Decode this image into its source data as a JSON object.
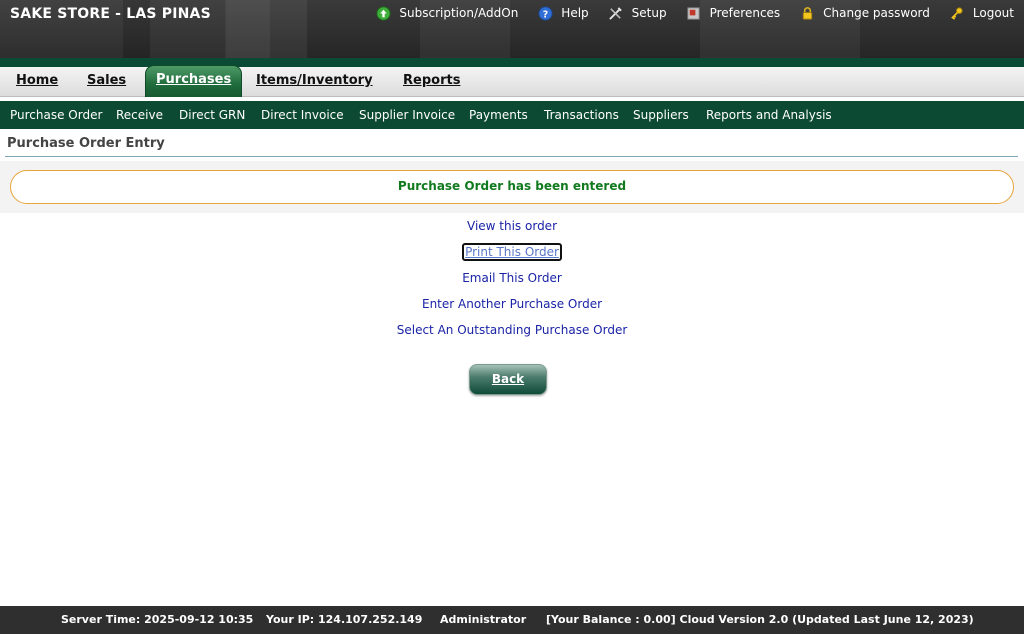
{
  "header": {
    "store_title": "SAKE STORE - LAS PINAS",
    "links": [
      {
        "label": "Subscription/AddOn",
        "icon": "upload-icon"
      },
      {
        "label": "Help",
        "icon": "help-icon"
      },
      {
        "label": "Setup",
        "icon": "tools-icon"
      },
      {
        "label": "Preferences",
        "icon": "preferences-icon"
      },
      {
        "label": "Change password",
        "icon": "lock-icon"
      },
      {
        "label": "Logout",
        "icon": "key-icon"
      }
    ]
  },
  "main_nav": {
    "tabs": [
      {
        "label": "Home"
      },
      {
        "label": "Sales"
      },
      {
        "label": "Purchases",
        "active": true
      },
      {
        "label": "Items/Inventory"
      },
      {
        "label": "Reports"
      }
    ]
  },
  "sub_nav": {
    "items": [
      {
        "label": "Purchase Order"
      },
      {
        "label": "Receive"
      },
      {
        "label": "Direct GRN"
      },
      {
        "label": "Direct Invoice"
      },
      {
        "label": "Supplier Invoice"
      },
      {
        "label": "Payments"
      },
      {
        "label": "Transactions"
      },
      {
        "label": "Suppliers"
      },
      {
        "label": "Reports and Analysis"
      }
    ]
  },
  "page": {
    "title": "Purchase Order Entry",
    "message": "Purchase Order has been entered",
    "actions": [
      {
        "label": "View this order"
      },
      {
        "label": "Print This Order"
      },
      {
        "label": "Email This Order"
      },
      {
        "label": "Enter Another Purchase Order"
      },
      {
        "label": "Select An Outstanding Purchase Order"
      }
    ],
    "back_label": "Back"
  },
  "footer": {
    "server_time": "Server Time: 2025-09-12 10:35",
    "ip": "Your IP: 124.107.252.149",
    "user": "Administrator",
    "balance_version": "[Your Balance : 0.00] Cloud Version 2.0 (Updated Last June 12, 2023)"
  },
  "colors": {
    "nav_green": "#0d4a33",
    "message_green": "#117a1e",
    "message_border": "#e7a43a",
    "link_blue": "#1a23a6"
  }
}
